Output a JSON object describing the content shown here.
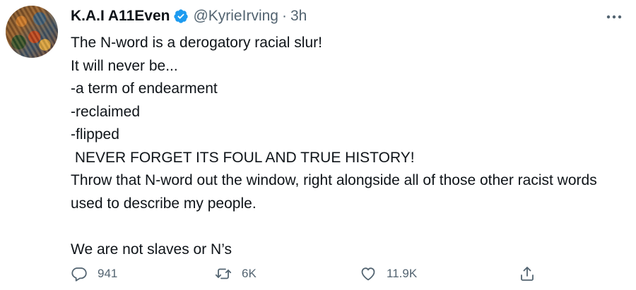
{
  "author": {
    "display_name": "K.A.I A11Even",
    "handle": "@KyrieIrving",
    "separator": "·",
    "time": "3h",
    "verified": true
  },
  "tweet": {
    "lines": [
      "The N-word is a derogatory racial slur!",
      "It will never be...",
      "-a term of endearment",
      "-reclaimed",
      "-flipped",
      " NEVER FORGET ITS FOUL AND TRUE HISTORY!",
      "Throw that N-word out the window, right alongside all of those other racist words used to describe my people.",
      "",
      "We are not slaves or N’s"
    ]
  },
  "actions": {
    "reply_count": "941",
    "retweet_count": "6K",
    "like_count": "11.9K"
  },
  "icons": {
    "verified": "verified-badge-icon",
    "more": "more-horizontal-icon",
    "reply": "reply-bubble-icon",
    "retweet": "retweet-icon",
    "like": "heart-icon",
    "share": "share-upload-icon"
  },
  "colors": {
    "verified": "#1d9bf0",
    "text": "#0f1419",
    "secondary": "#536471"
  }
}
